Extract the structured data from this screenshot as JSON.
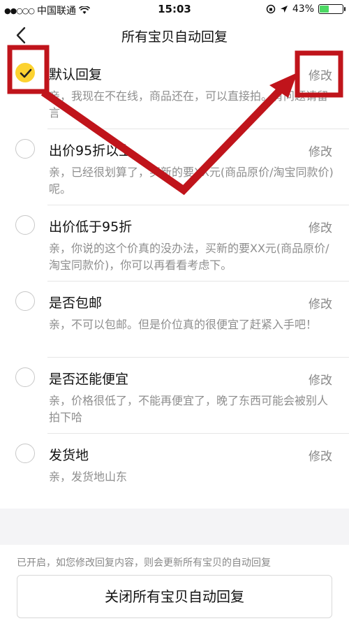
{
  "status_bar": {
    "carrier": "中国联通",
    "time": "15:03",
    "battery": "43%",
    "battery_level": 0.43
  },
  "nav": {
    "title": "所有宝贝自动回复"
  },
  "replies": [
    {
      "title": "默认回复",
      "body": "亲，我现在不在线，商品还在，可以直接拍。有问题请留言",
      "edit": "修改",
      "selected": true
    },
    {
      "title": "出价95折以上",
      "body": "亲，已经很划算了，买新的要XX元(商品原价/淘宝同款价)呢。",
      "edit": "修改",
      "selected": false
    },
    {
      "title": "出价低于95折",
      "body": "亲，你说的这个价真的没办法，买新的要XX元(商品原价/淘宝同款价)，你可以再看看考虑下。",
      "edit": "修改",
      "selected": false
    },
    {
      "title": "是否包邮",
      "body": "亲，不可以包邮。但是价位真的很便宜了赶紧入手吧！",
      "edit": "修改",
      "selected": false
    },
    {
      "title": "是否还能便宜",
      "body": "亲，价格很低了，不能再便宜了，晚了东西可能会被别人拍下哈",
      "edit": "修改",
      "selected": false
    },
    {
      "title": "发货地",
      "body": "亲，发货地山东",
      "edit": "修改",
      "selected": false
    }
  ],
  "footer": {
    "note": "已开启，如您修改回复内容，则会更新所有宝贝的自动回复",
    "close_button": "关闭所有宝贝自动回复"
  },
  "colors": {
    "accent": "#fcd230",
    "annotation": "#c0141b"
  }
}
